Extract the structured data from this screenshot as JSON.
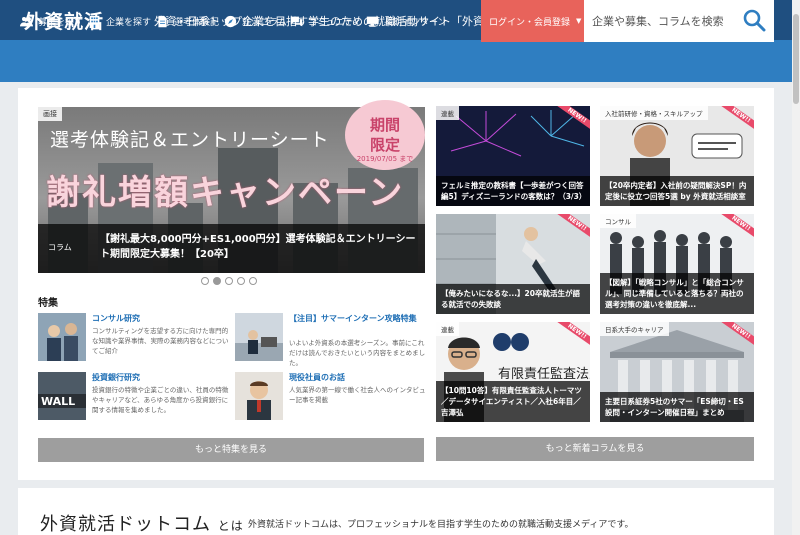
{
  "header": {
    "logo": "外資就活",
    "tagline": "外資・日系トップ企業を目指す学生のための就職活動サイト「外資就活ドットコム」",
    "facebook_glyph": "f",
    "twitter_glyph": "t"
  },
  "nav": {
    "items": [
      {
        "label": "募集を探す",
        "icon": "people-icon"
      },
      {
        "label": "企業を探す",
        "icon": "building-icon"
      },
      {
        "label": "選考体験記",
        "icon": "document-icon"
      },
      {
        "label": "就活コラム",
        "icon": "compass-icon"
      },
      {
        "label": "コミュニティ",
        "icon": "chat-icon"
      },
      {
        "label": "長期インターン",
        "icon": "monitor-icon"
      }
    ],
    "login_label": "ログイン・会員登録",
    "search_placeholder": "企業や募集、コラムを検索"
  },
  "hero": {
    "tag": "画接",
    "title_line1": "選考体験記＆エントリーシート",
    "title_line2": "謝礼増額キャンペーン",
    "badge_line1": "期間",
    "badge_line2": "限定",
    "badge_date": "2019/07/05 まで",
    "caption_label": "コラム",
    "caption_text": "【謝礼最大8,000円分+ES1,000円分】選考体験記＆エントリーシート期間限定大募集！【20卒】",
    "slide_count": 5,
    "active_slide": 2
  },
  "features": {
    "heading": "特集",
    "items": [
      {
        "title": "コンサル研究",
        "desc": "コンサルティングを志望する方に向けた専門的な知識や業界事情、実際の業務内容などについてご紹介"
      },
      {
        "title": "【注目】サマーインターン攻略特集",
        "desc": "いよいよ外資系の本選考シーズン。事前にこれだけは読んでおきたいという内容をまとめました。"
      },
      {
        "title": "投資銀行研究",
        "desc": "投資銀行の特徴や企業ごとの違い、社員の特徴やキャリアなど、あらゆる角度から投資銀行に関する情報を集めました。"
      },
      {
        "title": "現役社員のお話",
        "desc": "人気業界の第一線で働く社会人へのインタビュー記事を掲載"
      }
    ],
    "more_label": "もっと特集を見る"
  },
  "columns": {
    "cards": [
      {
        "tag": "連載",
        "new": "NEW!!",
        "text": "フェルミ推定の教科書【一歩差がつく回答編5】ディズニーランドの客数は？（3/3）"
      },
      {
        "tag": "入社前研修・資格・スキルアップ",
        "new": "NEW!!",
        "text": "【20卒内定者】入社前の疑問解決SP！内定後に役立つ回答5選 by 外資就活相談室"
      },
      {
        "tag": "",
        "new": "NEW!!",
        "text": "【俺みたいになるな...】20卒就活生が語る就活での失敗談"
      },
      {
        "tag": "コンサル",
        "new": "NEW!!",
        "text": "【図解】「戦略コンサル」と「総合コンサル」、同じ準備していると落ちる？両社の選考対策の違いを徹底解..."
      },
      {
        "tag": "連載",
        "new": "NEW!!",
        "text": "【10問10答】有限責任監査法人トーマツ／データサイエンティスト／入社6年目／吉澤弘"
      },
      {
        "tag": "日系大手のキャリア",
        "new": "NEW!!",
        "text": "主要日系証券5社のサマー「ES締切・ES設問・インターン開催日程」まとめ"
      }
    ],
    "more_label": "もっと新着コラムを見る"
  },
  "about": {
    "title": "外資就活ドットコム",
    "title_suffix": "とは",
    "text": "外資就活ドットコムは、プロフェッショナルを目指す学生のための就職活動支援メディアです。"
  },
  "colors": {
    "header_bg": "#1f4f80",
    "nav_bg": "#2f7ec1",
    "login_bg": "#e8635b",
    "link": "#1f6fb5"
  }
}
